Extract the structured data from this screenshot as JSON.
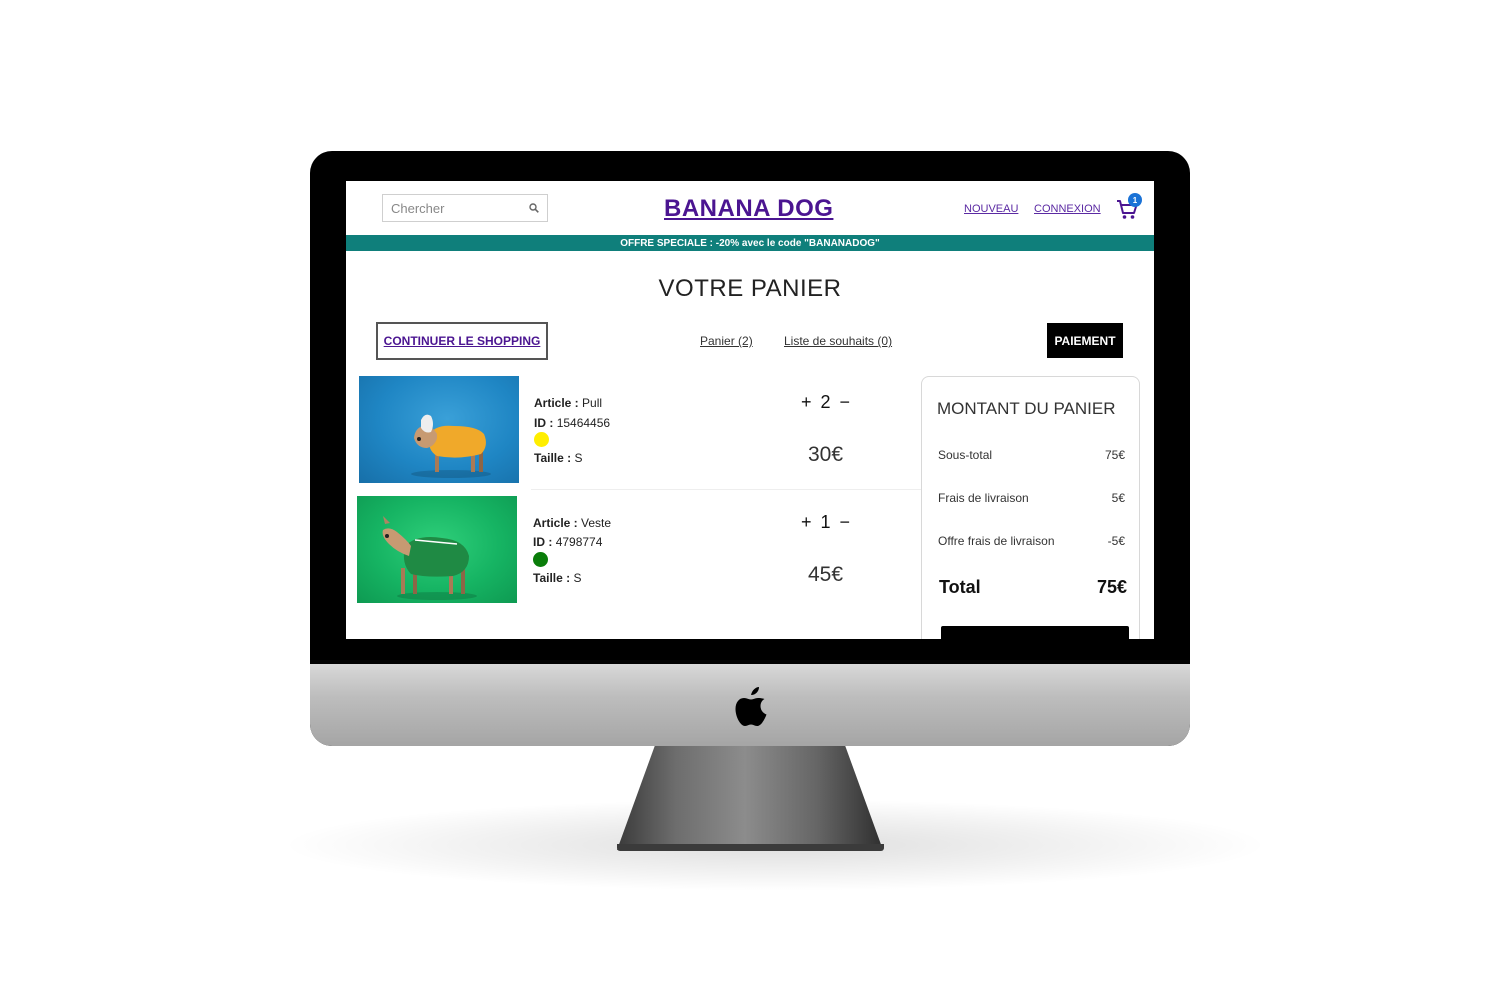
{
  "search": {
    "placeholder": "Chercher",
    "icon": "search-icon"
  },
  "brand": {
    "title": "BANANA DOG",
    "color": "#4b1591"
  },
  "nav": {
    "new_label": "NOUVEAU",
    "login_label": "CONNEXION",
    "cart_count": "1"
  },
  "promo": {
    "text": "OFFRE SPECIALE : -20% avec le code \"BANANADOG\"",
    "color": "#0f7f7b"
  },
  "page": {
    "title": "VOTRE PANIER"
  },
  "actions": {
    "continue_label": "CONTINUER LE SHOPPING",
    "cart_tab": "Panier (2)",
    "wishlist_tab": "Liste de souhaits (0)",
    "pay_label": "PAIEMENT"
  },
  "items": [
    {
      "article_label": "Article :",
      "article": "Pull",
      "id_label": "ID :",
      "id": "15464456",
      "color": "#ffee00",
      "size_label": "Taille :",
      "size": "S",
      "qty_plus": "+",
      "qty": "2",
      "qty_minus": "−",
      "price": "30€"
    },
    {
      "article_label": "Article :",
      "article": "Veste",
      "id_label": "ID :",
      "id": "4798774",
      "color": "#0a7d0a",
      "size_label": "Taille :",
      "size": "S",
      "qty_plus": "+",
      "qty": "1",
      "qty_minus": "−",
      "price": "45€"
    }
  ],
  "summary": {
    "title": "MONTANT DU PANIER",
    "subtotal_label": "Sous-total",
    "subtotal": "75€",
    "shipping_label": "Frais de livraison",
    "shipping": "5€",
    "offer_label": "Offre frais de livraison",
    "offer": "-5€",
    "total_label": "Total",
    "total": "75€"
  }
}
